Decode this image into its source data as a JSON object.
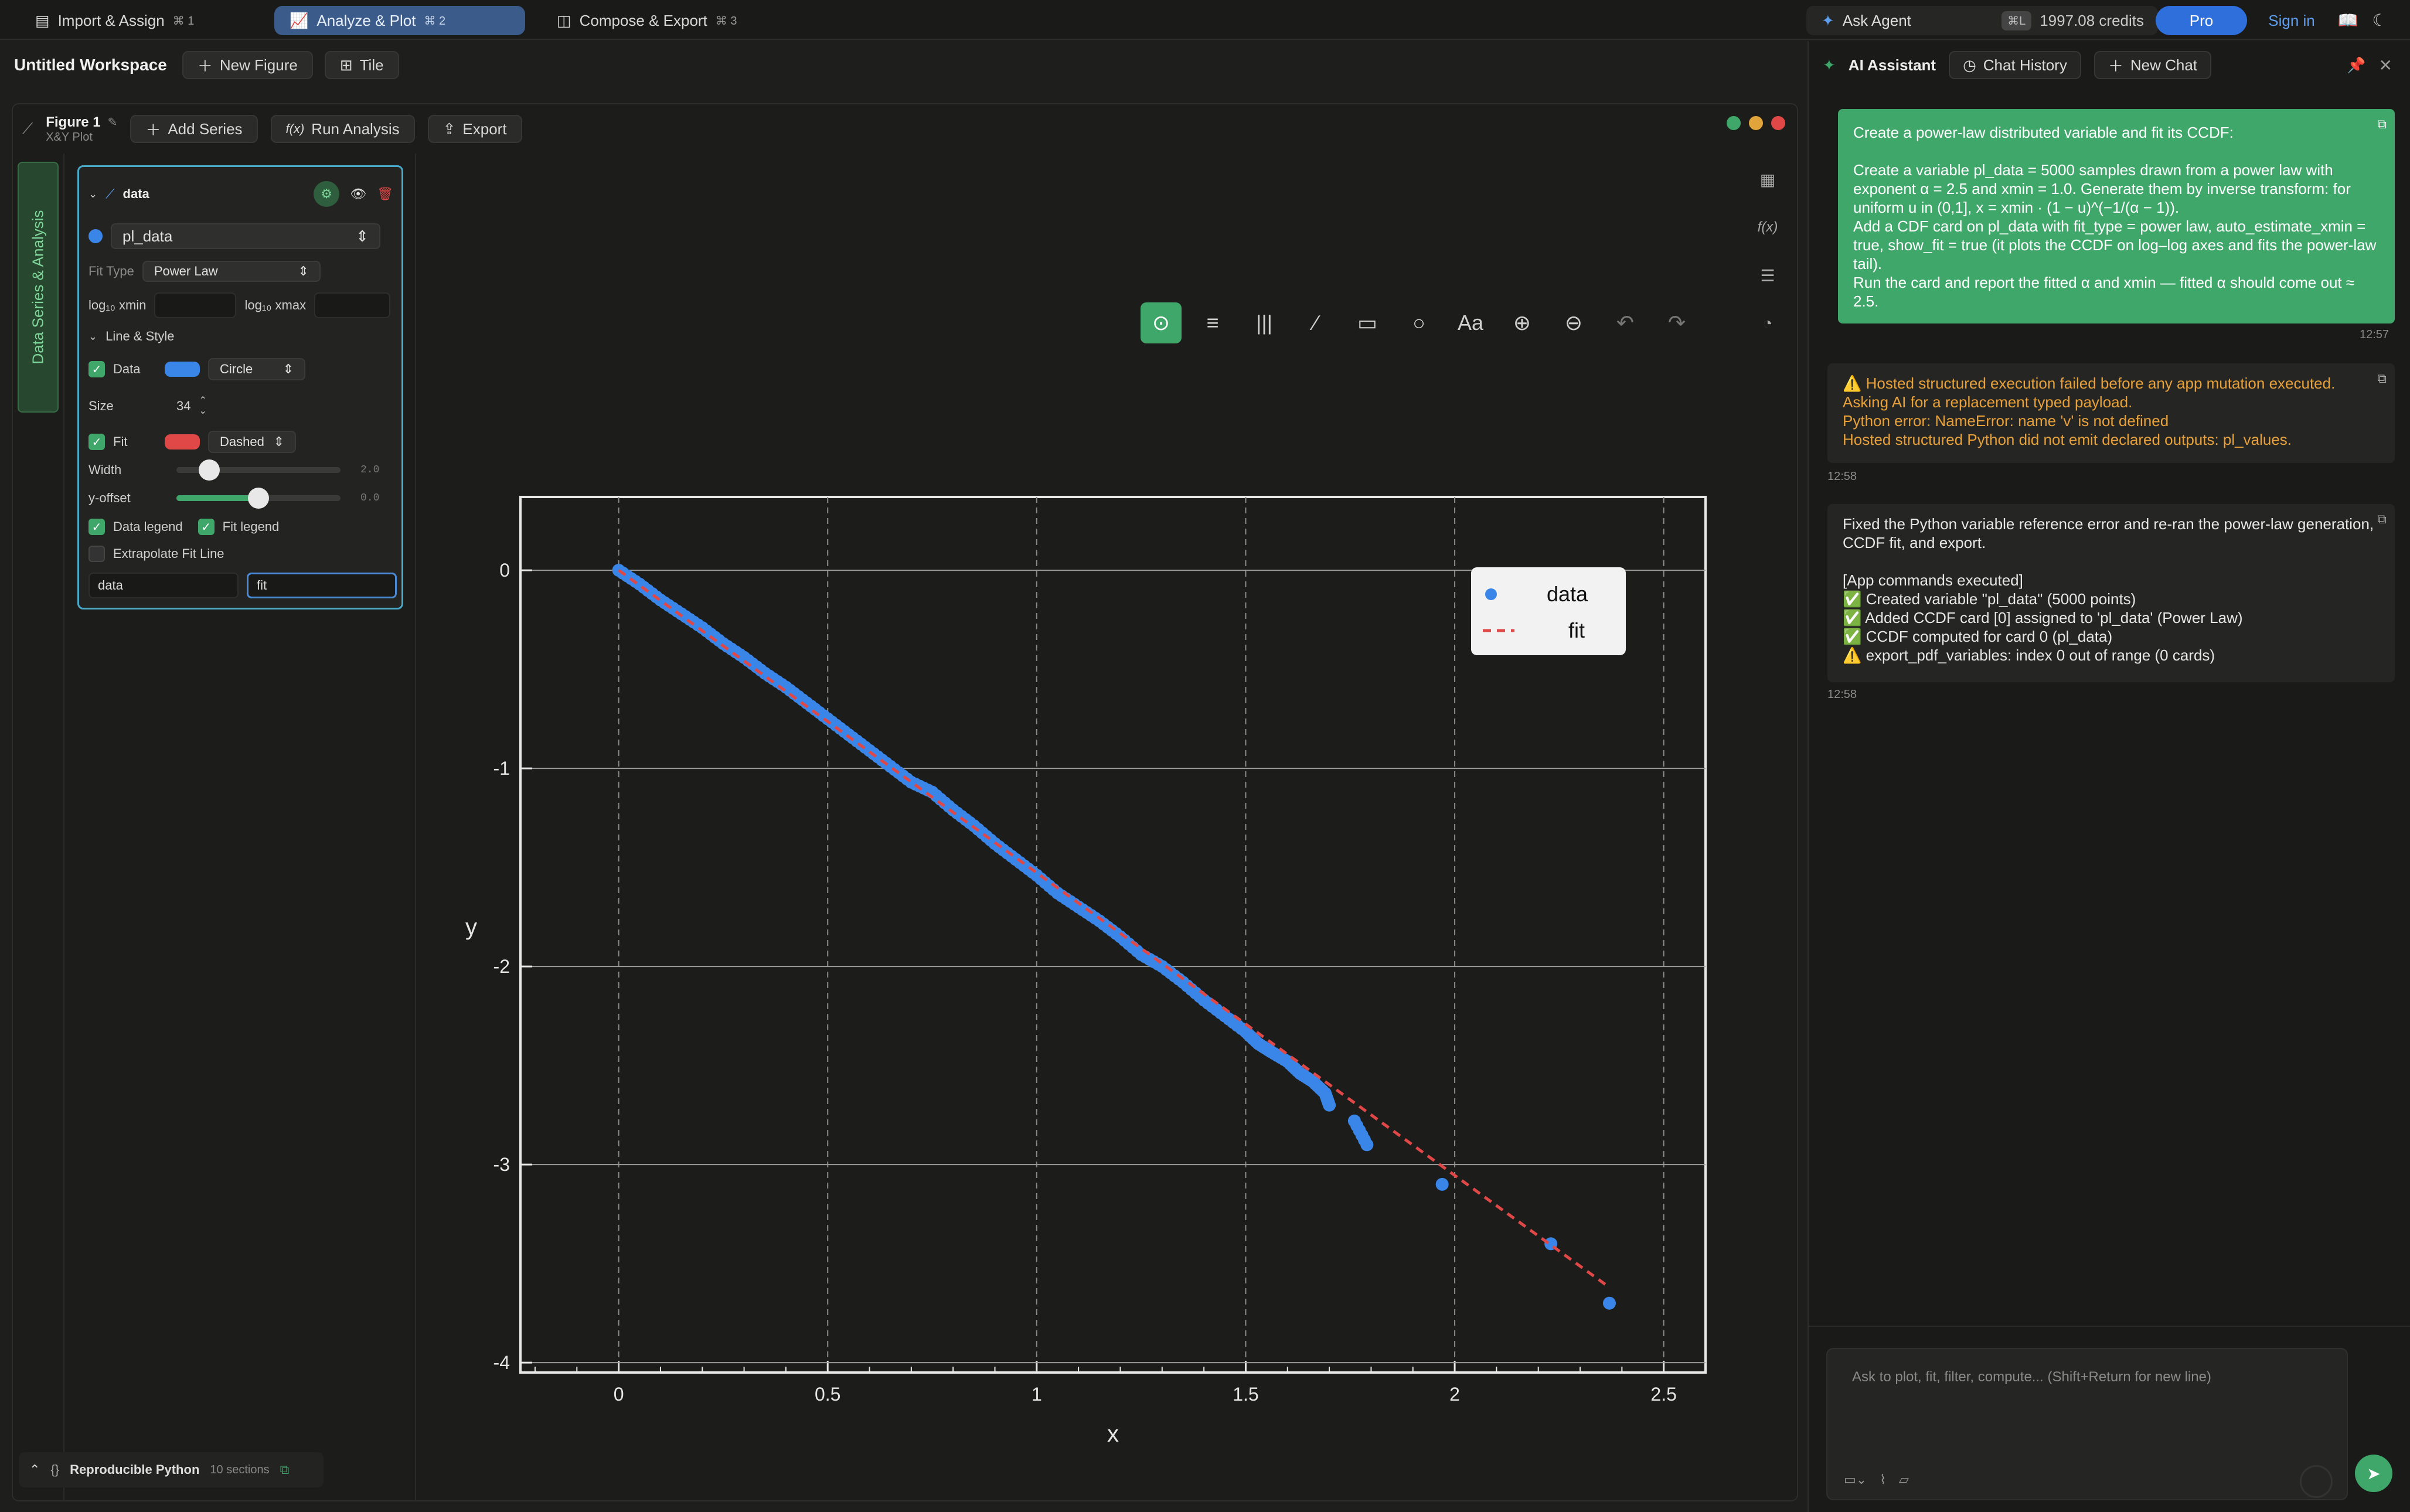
{
  "tabs": [
    {
      "label": "Import & Assign",
      "kbd": "⌘ 1"
    },
    {
      "label": "Analyze & Plot",
      "kbd": "⌘ 2"
    },
    {
      "label": "Compose & Export",
      "kbd": "⌘ 3"
    }
  ],
  "top": {
    "ask_agent": "Ask Agent",
    "shortcut": "⌘L",
    "credits": "1997.08 credits",
    "pro": "Pro",
    "sign_in": "Sign in"
  },
  "workspace": {
    "title": "Untitled Workspace",
    "new_figure": "New Figure",
    "tile": "Tile"
  },
  "figure": {
    "name": "Figure 1",
    "subtitle": "X&Y Plot",
    "add_series": "Add Series",
    "run_analysis": "Run Analysis",
    "fx": "f(x)",
    "export": "Export",
    "dot_colors": [
      "#3fa76a",
      "#e0a43a",
      "#e04848"
    ]
  },
  "side_tab": "Data Series & Analysis",
  "series_card": {
    "name": "data",
    "variable": "pl_data",
    "fit_type_label": "Fit Type",
    "fit_type": "Power Law",
    "xmin_label": "log₁₀ xmin",
    "xmax_label": "log₁₀ xmax",
    "line_style": "Line & Style",
    "data_label": "Data",
    "data_marker": "Circle",
    "data_color": "#3a86e8",
    "size_label": "Size",
    "size": "34",
    "fit_label": "Fit",
    "fit_style": "Dashed",
    "fit_color": "#e04848",
    "width_label": "Width",
    "width_value": "2.0",
    "width_level": 0.2,
    "yoffset_label": "y-offset",
    "yoffset_value": "0.0",
    "yoffset_level": 0.5,
    "data_legend": "Data legend",
    "fit_legend": "Fit legend",
    "extrapolate": "Extrapolate Fit Line",
    "legend_data_name": "data",
    "legend_fit_name": "fit"
  },
  "chart_data": {
    "type": "scatter",
    "xlabel": "x",
    "ylabel": "y",
    "xlim": [
      -0.235,
      2.6
    ],
    "ylim": [
      -4.05,
      0.37
    ],
    "xticks": [
      0,
      0.5,
      1,
      1.5,
      2,
      2.5
    ],
    "yticks": [
      0,
      -1,
      -2,
      -3,
      -4
    ],
    "xtick_labels": [
      "0",
      "0.5",
      "1",
      "1.5",
      "2",
      "2.5"
    ],
    "ytick_labels": [
      "0",
      "-1",
      "-2",
      "-3",
      "-4"
    ],
    "grid": true,
    "legend_position": "top-right",
    "series": [
      {
        "name": "data",
        "style": "points",
        "color": "#3a86e8",
        "x": [
          0,
          0.05,
          0.1,
          0.15,
          0.2,
          0.25,
          0.3,
          0.35,
          0.4,
          0.45,
          0.5,
          0.55,
          0.6,
          0.65,
          0.7,
          0.75,
          0.8,
          0.85,
          0.9,
          0.95,
          1.0,
          1.05,
          1.1,
          1.15,
          1.2,
          1.25,
          1.3,
          1.35,
          1.4,
          1.45,
          1.5,
          1.53,
          1.56,
          1.6,
          1.63,
          1.66,
          1.69,
          1.7,
          1.76,
          1.79,
          1.97,
          2.23,
          2.37
        ],
        "y": [
          0,
          -0.07,
          -0.15,
          -0.22,
          -0.29,
          -0.37,
          -0.44,
          -0.52,
          -0.59,
          -0.67,
          -0.75,
          -0.83,
          -0.91,
          -0.99,
          -1.07,
          -1.12,
          -1.21,
          -1.29,
          -1.38,
          -1.46,
          -1.54,
          -1.63,
          -1.7,
          -1.77,
          -1.85,
          -1.94,
          -2.0,
          -2.08,
          -2.17,
          -2.25,
          -2.33,
          -2.39,
          -2.43,
          -2.48,
          -2.54,
          -2.58,
          -2.64,
          -2.7,
          -2.78,
          -2.9,
          -3.1,
          -3.4,
          -3.7
        ]
      },
      {
        "name": "fit",
        "style": "dashed",
        "color": "#e04848",
        "x": [
          0,
          2.37
        ],
        "y": [
          0,
          -3.62
        ]
      }
    ]
  },
  "plot_tools": [
    "cursor-icon",
    "hlines-icon",
    "vlines-icon",
    "line-icon",
    "rect-icon",
    "circle-icon",
    "text-icon",
    "zoom-in-icon",
    "zoom-out-icon",
    "undo-icon",
    "redo-icon"
  ],
  "repro": {
    "label": "Reproducible Python",
    "sections": "10 sections"
  },
  "assistant": {
    "title": "AI Assistant",
    "history": "Chat History",
    "new_chat": "New Chat",
    "user_msg": "Create a power-law distributed variable and fit its CCDF:\n\nCreate a variable pl_data = 5000 samples drawn from a power law with exponent α = 2.5 and xmin = 1.0. Generate them by inverse transform: for uniform u in (0,1], x = xmin · (1 − u)^(−1/(α − 1)).\nAdd a CDF card on pl_data with fit_type = power law, auto_estimate_xmin = true, show_fit = true (it plots the CCDF on log–log axes and fits the power-law tail).\nRun the card and report the fitted α and xmin — fitted α should come out ≈ 2.5.",
    "user_time": "12:57",
    "warn_msg": "⚠️ Hosted structured execution failed before any app mutation executed. Asking AI for a replacement typed payload.\nPython error: NameError: name 'v' is not defined\nHosted structured Python did not emit declared outputs: pl_values.",
    "warn_time": "12:58",
    "ok_msg": "Fixed the Python variable reference error and re-ran the power-law generation, CCDF fit, and export.\n\n[App commands executed]\n✅ Created variable \"pl_data\" (5000 points)\n✅ Added CCDF card [0] assigned to 'pl_data' (Power Law)\n✅ CCDF computed for card 0 (pl_data)\n⚠️ export_pdf_variables: index 0 out of range (0 cards)",
    "ok_time": "12:58",
    "input_placeholder": "Ask to plot, fit, filter, compute... (Shift+Return for new line)"
  }
}
